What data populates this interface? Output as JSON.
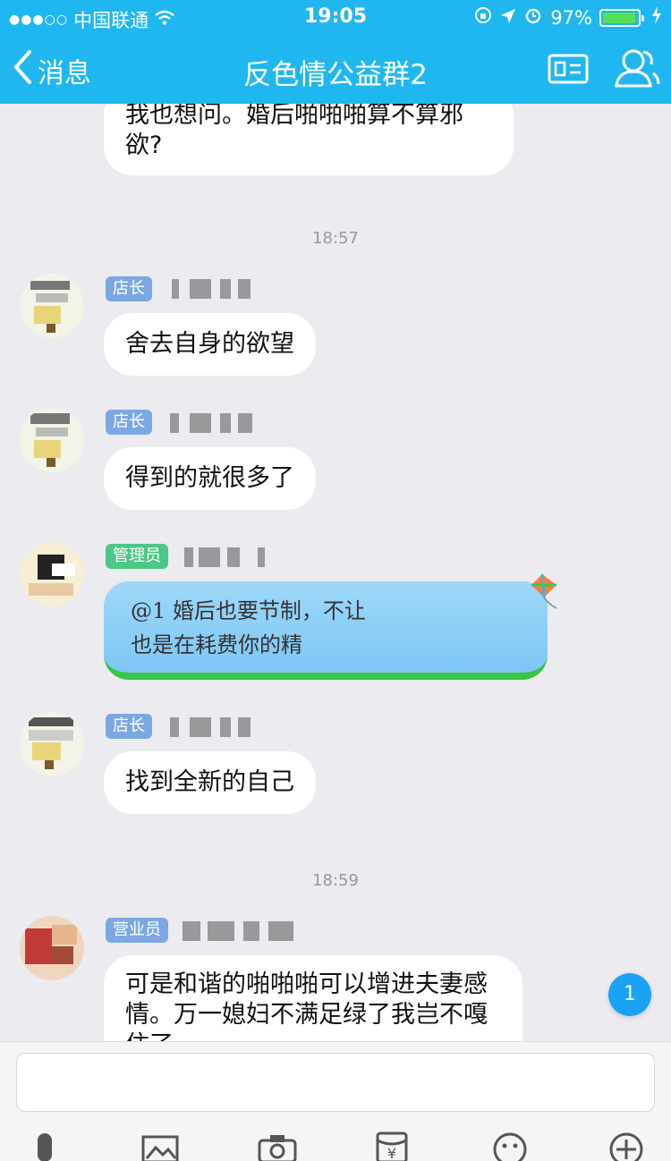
{
  "status": {
    "carrier": "中国联通",
    "time": "19:05",
    "battery": "97%",
    "battery_level": 0.97
  },
  "nav": {
    "back_label": "消息",
    "title": "反色情公益群2"
  },
  "chat": {
    "top_message": {
      "line1": "我也想问。婚后啪啪啪算不算邪",
      "line2": "欲?"
    },
    "time1": "18:57",
    "messages": [
      {
        "badge": "店长",
        "text": "舍去自身的欲望"
      },
      {
        "badge": "店长",
        "text": "得到的就很多了"
      },
      {
        "badge": "管理员",
        "line1": "@1    婚后也要节制，不让",
        "line2": "也是在耗费你的精"
      },
      {
        "badge": "店长",
        "text": "找到全新的自己"
      }
    ],
    "time2": "18:59",
    "last_message": {
      "badge": "营业员",
      "line1": "可是和谐的啪啪啪可以增进夫妻感",
      "line2": "情。万一媳妇不满足绿了我岂不嘎",
      "line3": "住了"
    },
    "unread_count": "1"
  },
  "input": {
    "value": ""
  },
  "icons": [
    "signal-icon",
    "wifi-icon",
    "lock-rotation-icon",
    "location-icon",
    "alarm-icon",
    "battery-icon",
    "charging-icon",
    "back-icon",
    "group-card-icon",
    "members-icon",
    "mic-icon",
    "image-icon",
    "camera-icon",
    "red-packet-icon",
    "emoji-icon",
    "plus-icon"
  ],
  "colors": {
    "header": "#20b7f0",
    "background": "#ebebf0",
    "badge_blue": "#7ca7e3",
    "badge_green": "#4cc786",
    "unread": "#1aa3f5"
  }
}
